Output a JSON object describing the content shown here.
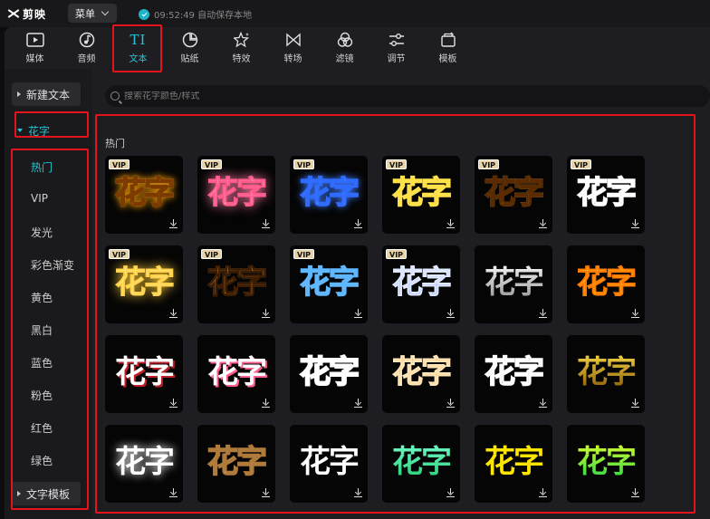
{
  "app": {
    "name": "剪映",
    "menu_label": "菜单",
    "save_status": "09:52:49 自动保存本地"
  },
  "toolbar": [
    {
      "label": "媒体",
      "icon": "media-icon"
    },
    {
      "label": "音频",
      "icon": "audio-icon"
    },
    {
      "label": "文本",
      "icon": "text-icon",
      "active": true
    },
    {
      "label": "贴纸",
      "icon": "sticker-icon"
    },
    {
      "label": "特效",
      "icon": "effects-icon"
    },
    {
      "label": "转场",
      "icon": "transition-icon"
    },
    {
      "label": "滤镜",
      "icon": "filter-icon"
    },
    {
      "label": "调节",
      "icon": "adjust-icon"
    },
    {
      "label": "模板",
      "icon": "template-icon"
    }
  ],
  "sidebar": {
    "new_text": "新建文本",
    "huazi": "花字",
    "items": [
      "热门",
      "VIP",
      "发光",
      "彩色渐变",
      "黄色",
      "黑白",
      "蓝色",
      "粉色",
      "红色",
      "绿色"
    ],
    "active_item": "热门",
    "text_template": "文字模板"
  },
  "search": {
    "placeholder": "搜索花字颜色/样式"
  },
  "section_title": "热门",
  "tile_text": "花字",
  "vip_label": "VIP",
  "tiles": [
    {
      "vip": true,
      "style": "gold-glow"
    },
    {
      "vip": true,
      "style": "pink-glow"
    },
    {
      "vip": true,
      "style": "blue-neon"
    },
    {
      "vip": true,
      "style": "red-yellow"
    },
    {
      "vip": true,
      "style": "gold-orange"
    },
    {
      "vip": true,
      "style": "red-white"
    },
    {
      "vip": true,
      "style": "yellow-glow"
    },
    {
      "vip": true,
      "style": "orange-stripe"
    },
    {
      "vip": true,
      "style": "pink-blue"
    },
    {
      "vip": true,
      "style": "blue-white"
    },
    {
      "vip": false,
      "style": "silver"
    },
    {
      "vip": false,
      "style": "yellow-orange"
    },
    {
      "vip": false,
      "style": "white-red"
    },
    {
      "vip": false,
      "style": "white-pink"
    },
    {
      "vip": false,
      "style": "white-outline"
    },
    {
      "vip": false,
      "style": "peach"
    },
    {
      "vip": false,
      "style": "black-outline"
    },
    {
      "vip": false,
      "style": "gold-dark"
    },
    {
      "vip": false,
      "style": "white-glow"
    },
    {
      "vip": false,
      "style": "cream"
    },
    {
      "vip": false,
      "style": "white-plain"
    },
    {
      "vip": false,
      "style": "green-gradient"
    },
    {
      "vip": false,
      "style": "yellow-plain"
    },
    {
      "vip": false,
      "style": "green-yellow"
    }
  ],
  "colors": {
    "accent": "#22c6d6",
    "annotation": "#e5141c",
    "vip_badge": "#e7d3a6"
  }
}
